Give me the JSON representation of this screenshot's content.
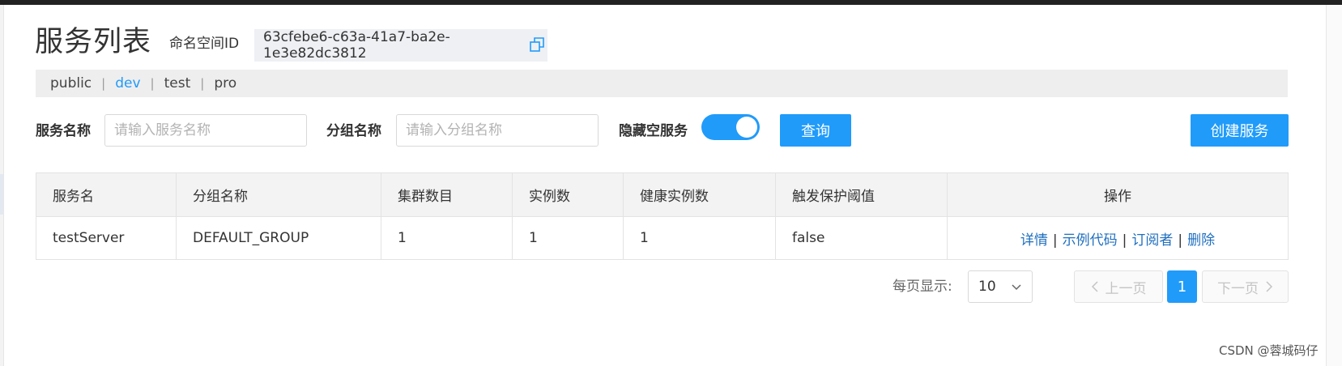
{
  "header": {
    "title": "服务列表",
    "namespace_label": "命名空间ID",
    "namespace_id": "63cfebe6-c63a-41a7-ba2e-1e3e82dc3812"
  },
  "namespaces": {
    "items": [
      "public",
      "dev",
      "test",
      "pro"
    ],
    "active": "dev",
    "separator": "|"
  },
  "filters": {
    "service_name_label": "服务名称",
    "service_name_placeholder": "请输入服务名称",
    "group_name_label": "分组名称",
    "group_name_placeholder": "请输入分组名称",
    "hide_empty_label": "隐藏空服务",
    "hide_empty_on": true,
    "query_button": "查询",
    "create_button": "创建服务"
  },
  "table": {
    "columns": [
      "服务名",
      "分组名称",
      "集群数目",
      "实例数",
      "健康实例数",
      "触发保护阈值",
      "操作"
    ],
    "rows": [
      {
        "service": "testServer",
        "group": "DEFAULT_GROUP",
        "clusters": "1",
        "instances": "1",
        "healthy": "1",
        "threshold": "false",
        "ops": [
          "详情",
          "示例代码",
          "订阅者",
          "删除"
        ]
      }
    ]
  },
  "pagination": {
    "page_size_label": "每页显示:",
    "page_size": "10",
    "prev_label": "上一页",
    "next_label": "下一页",
    "current_page": "1"
  },
  "watermark": "CSDN @蓉城码仔",
  "colors": {
    "primary": "#209bfa",
    "link": "#1f6fbf",
    "header_bg": "#f3f3f3"
  }
}
